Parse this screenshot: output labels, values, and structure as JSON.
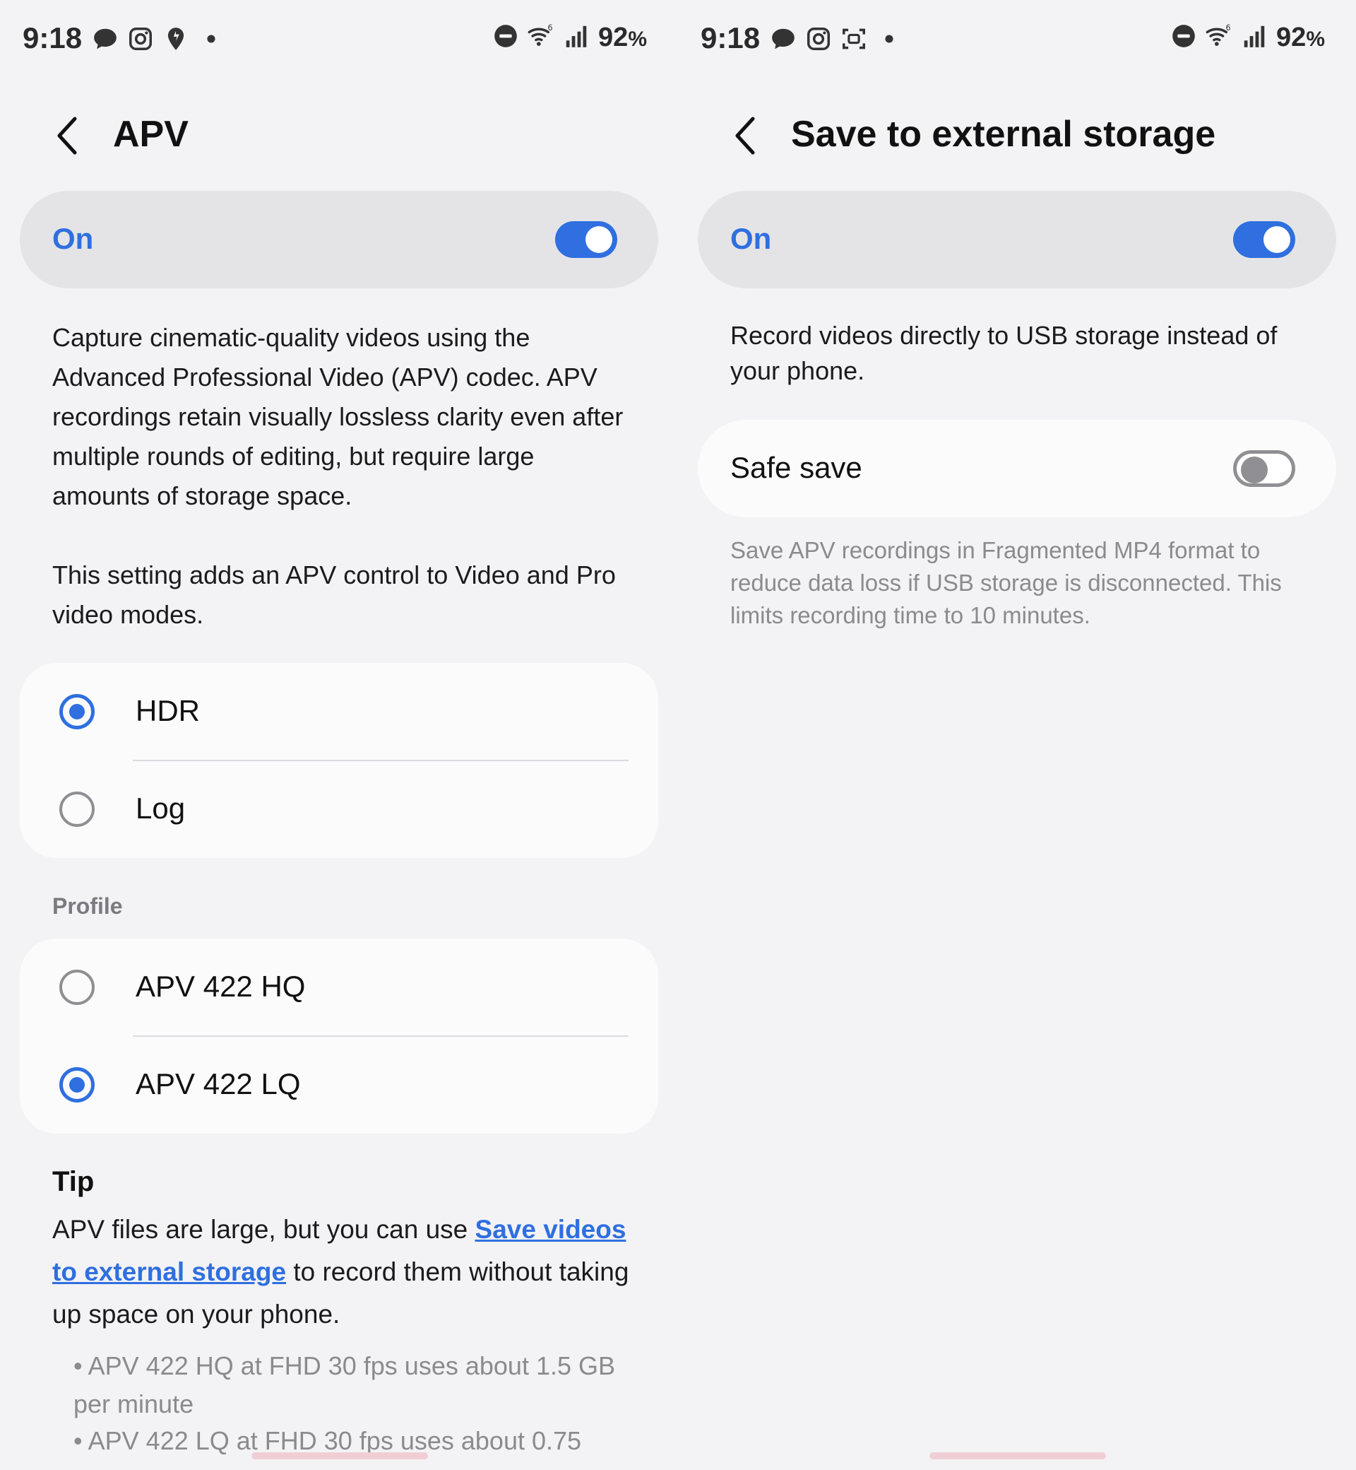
{
  "status": {
    "time": "9:18",
    "battery": "92",
    "battery_unit": "%",
    "left_icons": [
      "chat-bubble-icon",
      "instagram-icon",
      "notification-pin-icon",
      "dot-icon"
    ],
    "left_icons_right_screen": [
      "chat-bubble-icon",
      "instagram-icon",
      "screenshot-icon",
      "dot-icon"
    ],
    "right_icons": [
      "do-not-disturb-icon",
      "wifi-6-icon",
      "signal-bars-icon"
    ]
  },
  "apv": {
    "title": "APV",
    "master_label": "On",
    "master_on": true,
    "description": "Capture cinematic-quality videos using the Advanced Professional Video (APV) codec. APV recordings retain visually lossless clarity even after multiple rounds of editing, but require large amounts of storage space.",
    "setting_note": "This setting adds an APV control to Video and Pro video modes.",
    "mode_options": [
      {
        "label": "HDR",
        "selected": true
      },
      {
        "label": "Log",
        "selected": false
      }
    ],
    "profile_header": "Profile",
    "profile_options": [
      {
        "label": "APV 422 HQ",
        "selected": false
      },
      {
        "label": "APV 422 LQ",
        "selected": true
      }
    ],
    "tip": {
      "heading": "Tip",
      "text_before": "APV files are large, but you can use ",
      "link": "Save videos to external storage",
      "text_after": " to record them without taking up space on your phone.",
      "bullets": [
        "• APV 422 HQ at FHD 30 fps uses about 1.5 GB per minute",
        "• APV 422 LQ at FHD 30 fps uses about 0.75"
      ]
    }
  },
  "external": {
    "title": "Save to external storage",
    "master_label": "On",
    "master_on": true,
    "description": "Record videos directly to USB storage instead of your phone.",
    "safe_save_label": "Safe save",
    "safe_save_on": false,
    "safe_save_note": "Save APV recordings in Fragmented MP4 format to reduce data loss if USB storage is disconnected. This limits recording time to 10 minutes."
  },
  "colors": {
    "accent": "#2f6fdf",
    "background": "#f3f3f5",
    "card": "#fbfbfc",
    "master_bg": "#e4e4e7",
    "secondary_text": "#8a8a8f"
  }
}
